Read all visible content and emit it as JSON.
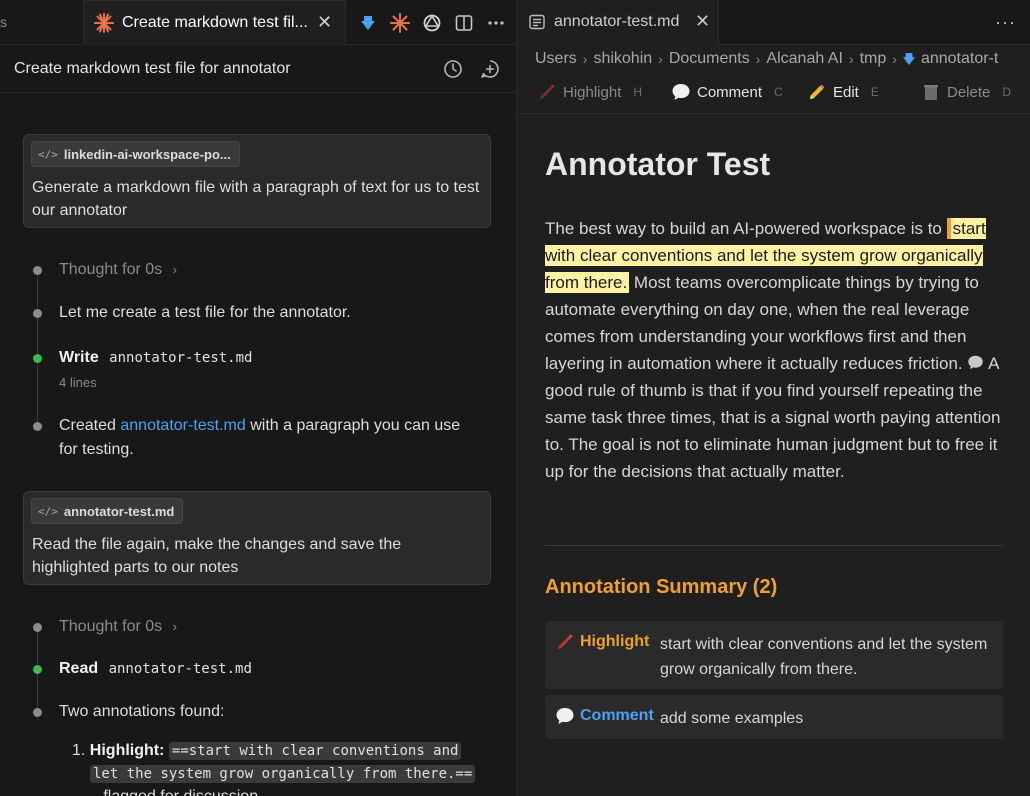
{
  "left": {
    "stub_tab_label": "s",
    "active_tab_title": "Create markdown test fil...",
    "conversation_title": "Create markdown test file for annotator",
    "messages": [
      {
        "chip": "linkedin-ai-workspace-po...",
        "text": "Generate a markdown file with a paragraph of text for us to test our annotator"
      },
      {
        "chip": "annotator-test.md",
        "text": "Read the file again, make the changes and save the highlighted parts to our notes"
      }
    ],
    "timeline1": {
      "thought": "Thought for 0s",
      "step": "Let me create a test file for the annotator.",
      "write_label": "Write",
      "write_file": "annotator-test.md",
      "write_lines": "4 lines",
      "created_prefix": "Created",
      "created_link": "annotator-test.md",
      "created_suffix": "with a paragraph you can use",
      "created_line2": "for testing."
    },
    "timeline2": {
      "thought": "Thought for 0s",
      "read_label": "Read",
      "read_file": "annotator-test.md",
      "found": "Two annotations found:",
      "item1_num": "1.",
      "item1_label": "Highlight:",
      "item1_code_a": "==start with clear conventions and",
      "item1_code_b": "let the system grow organically from there.==",
      "item1_tail": "– flagged for discussion"
    }
  },
  "right": {
    "tab_title": "annotator-test.md",
    "breadcrumb": [
      "Users",
      "shikohin",
      "Documents",
      "Alcanah AI",
      "tmp",
      "annotator-t"
    ],
    "toolbar": {
      "highlight": {
        "label": "Highlight",
        "key": "H"
      },
      "comment": {
        "label": "Comment",
        "key": "C"
      },
      "edit": {
        "label": "Edit",
        "key": "E"
      },
      "delete": {
        "label": "Delete",
        "key": "D"
      }
    },
    "doc_title": "Annotator Test",
    "para_before": "The best way to build an AI-powered workspace is to ",
    "para_highlight": "start with clear conventions and let the system grow organically from there.",
    "para_middle": " Most teams overcomplicate things by trying to automate everything on day one, when the real leverage comes from understanding your workflows first and then layering in automation where it actually reduces friction. ",
    "para_after": " A good rule of thumb is that if you find yourself repeating the same task three times, that is a signal worth paying attention to. The goal is not to eliminate human judgment but to free it up for the decisions that actually matter.",
    "summary_title": "Annotation Summary (2)",
    "annotations": [
      {
        "kind": "Highlight",
        "text": "start with clear conventions and let the system grow organically from there.",
        "color": "#f0a030"
      },
      {
        "kind": "Comment",
        "text": "add some examples",
        "color": "#4ea1f0"
      }
    ]
  },
  "colors": {
    "accent_orange": "#f0a030",
    "link_blue": "#4ea1f0",
    "highlight_yellow": "#fff3a3",
    "status_green": "#3fb950",
    "claude_orange": "#e8734a"
  }
}
